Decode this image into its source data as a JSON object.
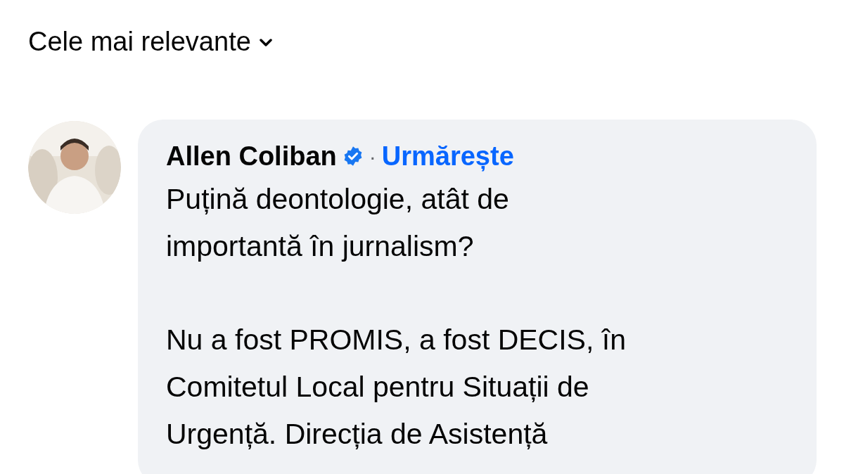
{
  "sort": {
    "label": "Cele mai relevante"
  },
  "comment": {
    "author": "Allen Coliban",
    "verified": true,
    "separator": "·",
    "follow": "Urmărește",
    "avatar": {
      "kind": "picture"
    },
    "paragraphs": [
      [
        "Puțină deontologie, atât de",
        "importantă în jurnalism?"
      ],
      [
        "Nu a fost PROMIS, a fost DECIS, în",
        "Comitetul Local pentru Situații de",
        "Urgență. Direcția de Asistență"
      ]
    ]
  }
}
